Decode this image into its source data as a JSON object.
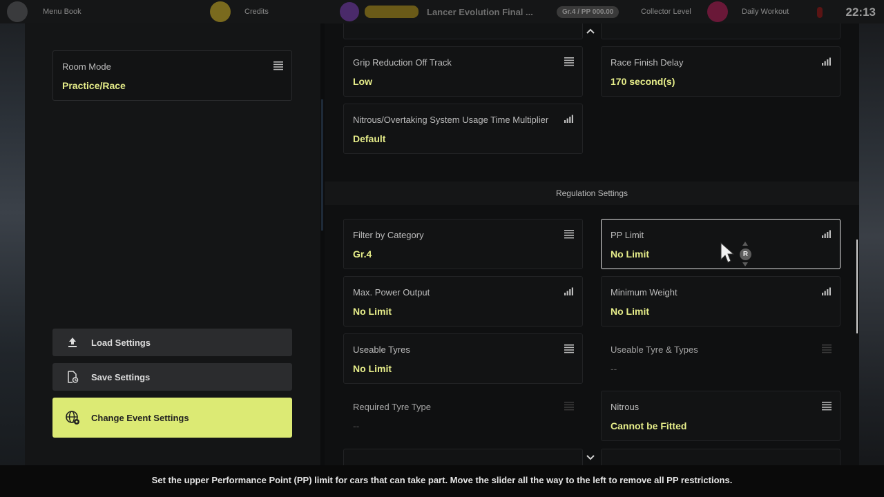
{
  "topbar": {
    "profile_label": "Menu Book",
    "credits_label": "Credits",
    "car_title": "Lancer Evolution Final ...",
    "car_pill": "Gr.4 / PP 000.00",
    "collector_label": "Collector Level",
    "daily_label": "Daily Workout",
    "clock": "22:13"
  },
  "left": {
    "room_mode": {
      "label": "Room Mode",
      "value": "Practice/Race"
    },
    "buttons": [
      {
        "label": "Load Settings"
      },
      {
        "label": "Save Settings"
      },
      {
        "label": "Change Event Settings"
      }
    ]
  },
  "right": {
    "cards_top": [
      {
        "label": "Grip Reduction Off Track",
        "value": "Low",
        "icon": "list-icon"
      },
      {
        "label": "Race Finish Delay",
        "value": "170 second(s)",
        "icon": "signal-bars-icon"
      },
      {
        "label": "Nitrous/Overtaking System Usage Time Multiplier",
        "value": "Default",
        "icon": "signal-bars-icon"
      }
    ],
    "section_title": "Regulation Settings",
    "cards_regulation": [
      {
        "label": "Filter by Category",
        "value": "Gr.4",
        "icon": "list-icon"
      },
      {
        "label": "PP Limit",
        "value": "No Limit",
        "icon": "signal-bars-icon"
      },
      {
        "label": "Max. Power Output",
        "value": "No Limit",
        "icon": "signal-bars-icon"
      },
      {
        "label": "Minimum Weight",
        "value": "No Limit",
        "icon": "signal-bars-icon"
      },
      {
        "label": "Useable Tyres",
        "value": "No Limit",
        "icon": "list-icon"
      },
      {
        "label": "Useable Tyre & Types",
        "value": "--",
        "icon": "list-icon"
      },
      {
        "label": "Required Tyre Type",
        "value": "--",
        "icon": "list-icon"
      },
      {
        "label": "Nitrous",
        "value": "Cannot be Fitted",
        "icon": "list-icon"
      }
    ],
    "r_badge": "R"
  },
  "help_text": "Set the upper Performance Point (PP) limit for cars that can take part. Move the slider all the way to the left to remove all PP restrictions.",
  "colors": {
    "accent": "#dcea74",
    "value_text": "#e7ee8a",
    "panel": "#141516"
  }
}
